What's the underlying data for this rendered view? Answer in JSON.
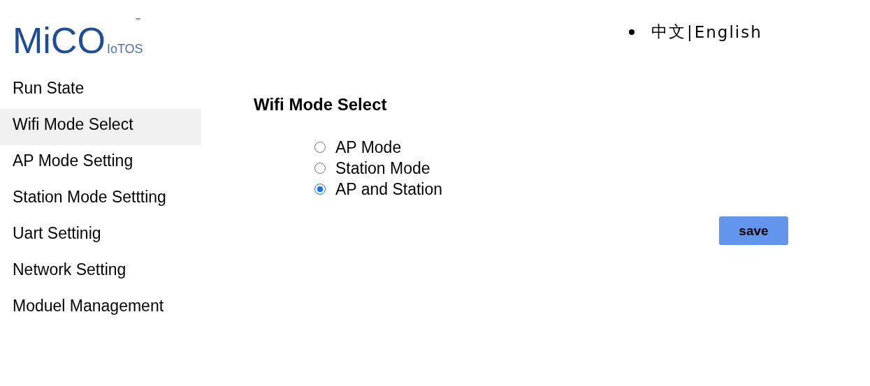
{
  "logo": {
    "name": "MiCO",
    "sub": "IoTOS",
    "tm": "™"
  },
  "language": {
    "items": [
      {
        "label": "中文"
      },
      {
        "label": "English"
      }
    ],
    "separator": "|"
  },
  "sidebar": {
    "items": [
      {
        "label": "Run State",
        "selected": false
      },
      {
        "label": "Wifi Mode Select",
        "selected": true
      },
      {
        "label": "AP Mode Setting",
        "selected": false
      },
      {
        "label": "Station Mode Settting",
        "selected": false
      },
      {
        "label": "Uart Settinig",
        "selected": false
      },
      {
        "label": "Network Setting",
        "selected": false
      },
      {
        "label": "Moduel Management",
        "selected": false
      }
    ]
  },
  "main": {
    "title": "Wifi Mode Select",
    "options": [
      {
        "label": "AP Mode",
        "selected": false
      },
      {
        "label": "Station Mode",
        "selected": false
      },
      {
        "label": "AP and Station",
        "selected": true
      }
    ],
    "save_button": "save"
  }
}
